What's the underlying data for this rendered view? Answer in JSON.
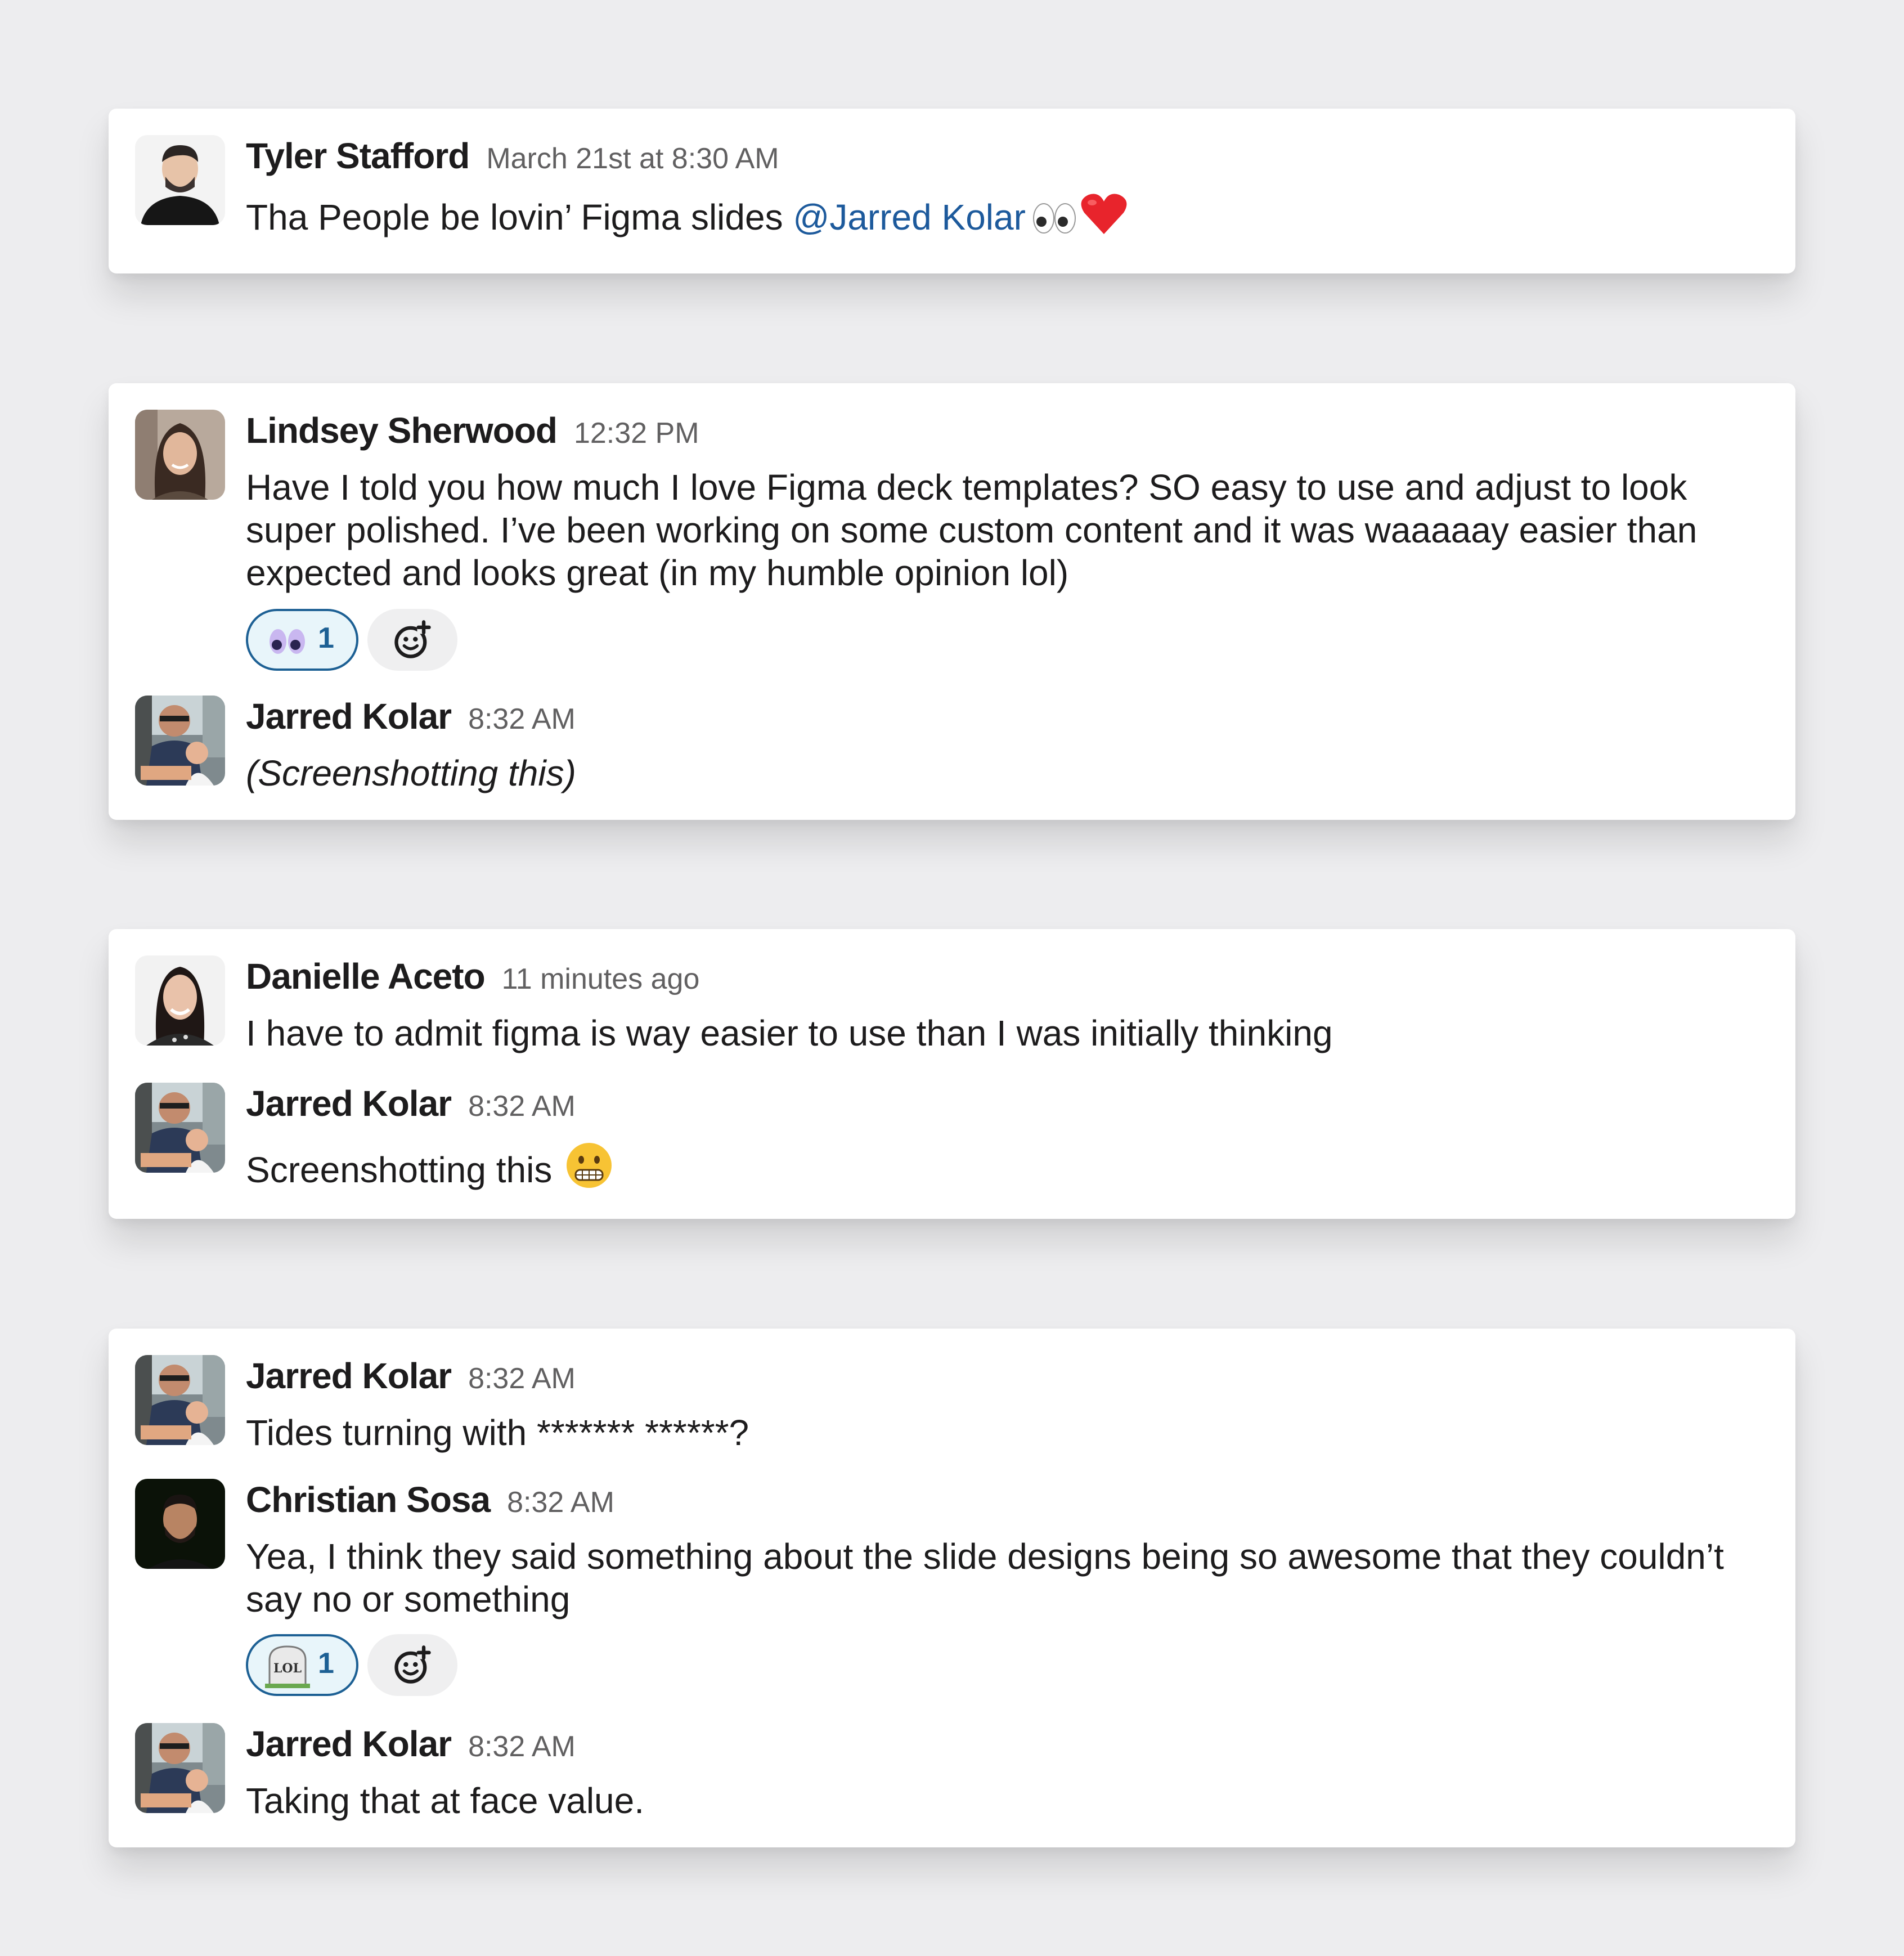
{
  "threads": [
    {
      "messages": [
        {
          "author": "Tyler Stafford",
          "time": "March 21st at 8:30 AM",
          "text": "Tha People be lovin’ Figma slides ",
          "mention": "@Jarred Kolar",
          "emojis": [
            "eyes",
            "red-heart"
          ]
        }
      ]
    },
    {
      "messages": [
        {
          "author": "Lindsey Sherwood",
          "time": "12:32 PM",
          "text": "Have I told you how much I love Figma deck templates? SO easy to use and adjust to look super polished. I’ve been working on some custom content and it was waaaaay easier than expected and looks great (in my humble opinion lol)",
          "reaction": {
            "emoji": "eyes-purple",
            "count": "1"
          }
        },
        {
          "author": "Jarred Kolar",
          "time": "8:32 AM",
          "text": "(Screenshotting this)"
        }
      ]
    },
    {
      "messages": [
        {
          "author": "Danielle Aceto",
          "time": "11 minutes ago",
          "text": "I have to admit figma is way easier to use than I was initially thinking"
        },
        {
          "author": "Jarred Kolar",
          "time": "8:32 AM",
          "text": "Screenshotting this",
          "emojis": [
            "grimacing-face"
          ]
        }
      ]
    },
    {
      "messages": [
        {
          "author": "Jarred Kolar",
          "time": "8:32 AM",
          "text": "Tides turning with ******* ******?"
        },
        {
          "author": "Christian Sosa",
          "time": "8:32 AM",
          "text": "Yea, I think they said something about the slide designs being so awesome that they couldn’t say no or something",
          "reaction": {
            "emoji": "lol-tombstone",
            "emoji_text": "LOL",
            "count": "1"
          }
        },
        {
          "author": "Jarred Kolar",
          "time": "8:32 AM",
          "text": "Taking that at face value."
        }
      ]
    }
  ],
  "colors": {
    "background": "#ededef",
    "mention": "#1d5a9c",
    "reaction_border": "#1d6094",
    "reaction_bg": "#e8f5fa",
    "timestamp": "#616061"
  },
  "icons": [
    "add-reaction-icon",
    "eyes-emoji",
    "red-heart-emoji",
    "grimacing-face-emoji",
    "lol-tombstone-emoji"
  ]
}
